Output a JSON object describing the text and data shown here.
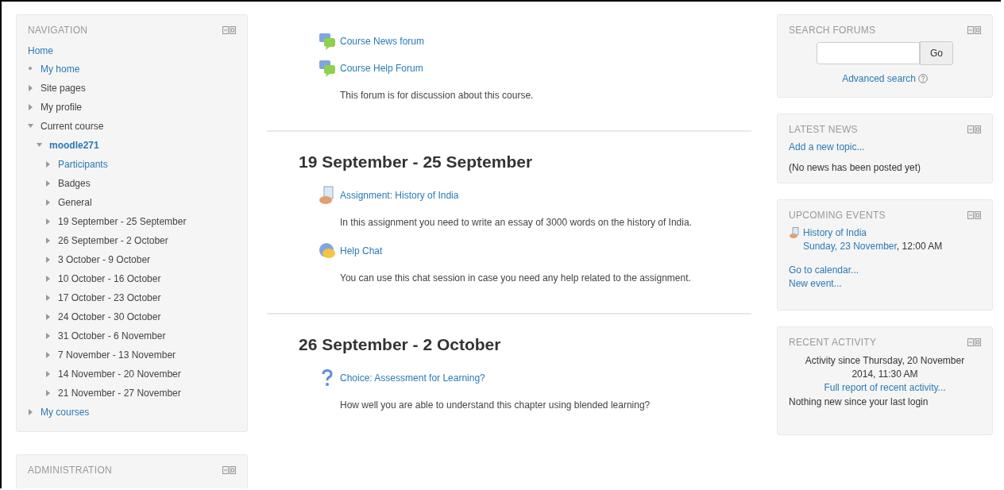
{
  "navigation": {
    "title": "NAVIGATION",
    "home": "Home",
    "items": [
      {
        "label": "My home",
        "kind": "bullet",
        "link": true
      },
      {
        "label": "Site pages",
        "kind": "branch",
        "link": false,
        "expanded": false
      },
      {
        "label": "My profile",
        "kind": "branch",
        "link": false,
        "expanded": false
      },
      {
        "label": "Current course",
        "kind": "branch",
        "link": false,
        "expanded": true,
        "children": [
          {
            "label": "moodle271",
            "kind": "branch",
            "link": true,
            "current": true,
            "expanded": true,
            "children": [
              {
                "label": "Participants",
                "kind": "branch",
                "link": true,
                "expanded": false
              },
              {
                "label": "Badges",
                "kind": "branch",
                "link": false,
                "expanded": false
              },
              {
                "label": "General",
                "kind": "branch",
                "link": false,
                "expanded": false
              },
              {
                "label": "19 September - 25 September",
                "kind": "branch",
                "link": false,
                "expanded": false
              },
              {
                "label": "26 September - 2 October",
                "kind": "branch",
                "link": false,
                "expanded": false
              },
              {
                "label": "3 October - 9 October",
                "kind": "branch",
                "link": false,
                "expanded": false
              },
              {
                "label": "10 October - 16 October",
                "kind": "branch",
                "link": false,
                "expanded": false
              },
              {
                "label": "17 October - 23 October",
                "kind": "branch",
                "link": false,
                "expanded": false
              },
              {
                "label": "24 October - 30 October",
                "kind": "branch",
                "link": false,
                "expanded": false
              },
              {
                "label": "31 October - 6 November",
                "kind": "branch",
                "link": false,
                "expanded": false
              },
              {
                "label": "7 November - 13 November",
                "kind": "branch",
                "link": false,
                "expanded": false
              },
              {
                "label": "14 November - 20 November",
                "kind": "branch",
                "link": false,
                "expanded": false
              },
              {
                "label": "21 November - 27 November",
                "kind": "branch",
                "link": false,
                "expanded": false
              }
            ]
          }
        ]
      },
      {
        "label": "My courses",
        "kind": "branch",
        "link": true,
        "expanded": false
      }
    ]
  },
  "administration": {
    "title": "ADMINISTRATION"
  },
  "sections": [
    {
      "activities": [
        {
          "kind": "forum",
          "name": "Course News forum"
        },
        {
          "kind": "forum",
          "name": "Course Help Forum",
          "description": "This forum is for discussion about this course."
        }
      ]
    },
    {
      "title": "19 September - 25 September",
      "activities": [
        {
          "kind": "assignment",
          "name": "Assignment: History of India",
          "description": "In this assignment you need to write an essay of 3000 words on the history of India."
        },
        {
          "kind": "chat",
          "name": "Help Chat",
          "description": "You can use this chat session in case you need any help related to the assignment."
        }
      ]
    },
    {
      "title": "26 September - 2 October",
      "activities": [
        {
          "kind": "choice",
          "name": "Choice: Assessment for Learning?",
          "description": "How well you are able to understand this chapter using blended learning?"
        }
      ]
    }
  ],
  "search_forums": {
    "title": "SEARCH FORUMS",
    "button": "Go",
    "advanced": "Advanced search"
  },
  "latest_news": {
    "title": "LATEST NEWS",
    "link": "Add a new topic...",
    "message": "(No news has been posted yet)"
  },
  "upcoming_events": {
    "title": "UPCOMING EVENTS",
    "events": [
      {
        "name": "History of India",
        "date": "Sunday, 23 November",
        "time": ", 12:00 AM"
      }
    ],
    "links": [
      "Go to calendar...",
      "New event..."
    ]
  },
  "recent_activity": {
    "title": "RECENT ACTIVITY",
    "since": "Activity since Thursday, 20 November 2014, 11:30 AM",
    "report": "Full report of recent activity...",
    "message": "Nothing new since your last login"
  }
}
